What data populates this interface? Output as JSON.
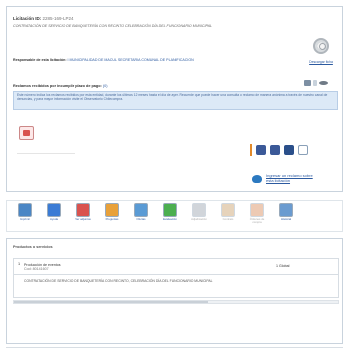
{
  "colors": {
    "link": "#2c5aa0",
    "claims_bg": "#dce9f7",
    "accent_orange": "#e28a2a",
    "pdf_red": "#d9534f"
  },
  "licitacion": {
    "id_label": "Licitación ID:",
    "id_value": "2285-169-LP24",
    "description": "CONTRATACIÓN DE SERVICIO DE BANQUETERÍA CON RECINTO CELEBRACIÓN DÍA DEL FUNCIONARIO MUNICIPAL",
    "responsible_label": "Responsable de esta licitación:",
    "responsible_value": "I MUNICIPALIDAD DE MACUL SECRETARIA COMUNAL DE PLANIFICACION",
    "claims_label": "Reclamos recibidos por incumplir plazo de pago:",
    "claims_value": "(0)",
    "claims_notice": "Este número indica los reclamos recibidos por esta entidad, durante los últimos 12 meses hasta el día de ayer. Recuerde que puede hacer una consulta o reclamo de manera anónima a través de nuestro canal de denuncias, y para mayor información visite el Observatorio Chilecompra.",
    "badge_label": "Descargar ficha"
  },
  "social": {
    "icons": [
      "facebook-icon",
      "twitter-icon",
      "linkedin-icon",
      "mail-icon"
    ]
  },
  "report": {
    "label": "Ingresar un reclamo sobre esta licitación"
  },
  "toolbar": {
    "tools": [
      {
        "name": "print-tool",
        "label": "Imprimir",
        "enabled": true,
        "color": "#4a86c5"
      },
      {
        "name": "help-tool",
        "label": "Ayuda",
        "enabled": true,
        "color": "#3a7bd5"
      },
      {
        "name": "attachments-tool",
        "label": "Ver adjuntos",
        "enabled": true,
        "color": "#d9534f"
      },
      {
        "name": "questions-tool",
        "label": "Preguntas",
        "enabled": true,
        "color": "#e8a13a"
      },
      {
        "name": "offers-tool",
        "label": "Ofertas",
        "enabled": true,
        "color": "#5a9bd5"
      },
      {
        "name": "evaluation-tool",
        "label": "Evaluación",
        "enabled": true,
        "color": "#4caf50"
      },
      {
        "name": "award-tool",
        "label": "Adjudicación",
        "enabled": false,
        "color": "#9aa4ae"
      },
      {
        "name": "contract-tool",
        "label": "Contrato",
        "enabled": false,
        "color": "#c9a06a"
      },
      {
        "name": "purchase-order-tool",
        "label": "Órdenes de compra",
        "enabled": false,
        "color": "#d98b5a"
      },
      {
        "name": "history-tool",
        "label": "Historial",
        "enabled": true,
        "color": "#6a9bd0"
      }
    ]
  },
  "products": {
    "title": "Productos o servicios",
    "rows": [
      {
        "number": "1",
        "name": "Producción de eventos",
        "code": "Cod: 80141607",
        "quantity": "1 Global",
        "description": "CONTRATACIÓN DE SERVICIO DE BANQUETERÍA CON RECINTO, CELEBRACIÓN DÍA DEL FUNCIONARIO MUNICIPAL"
      }
    ]
  }
}
